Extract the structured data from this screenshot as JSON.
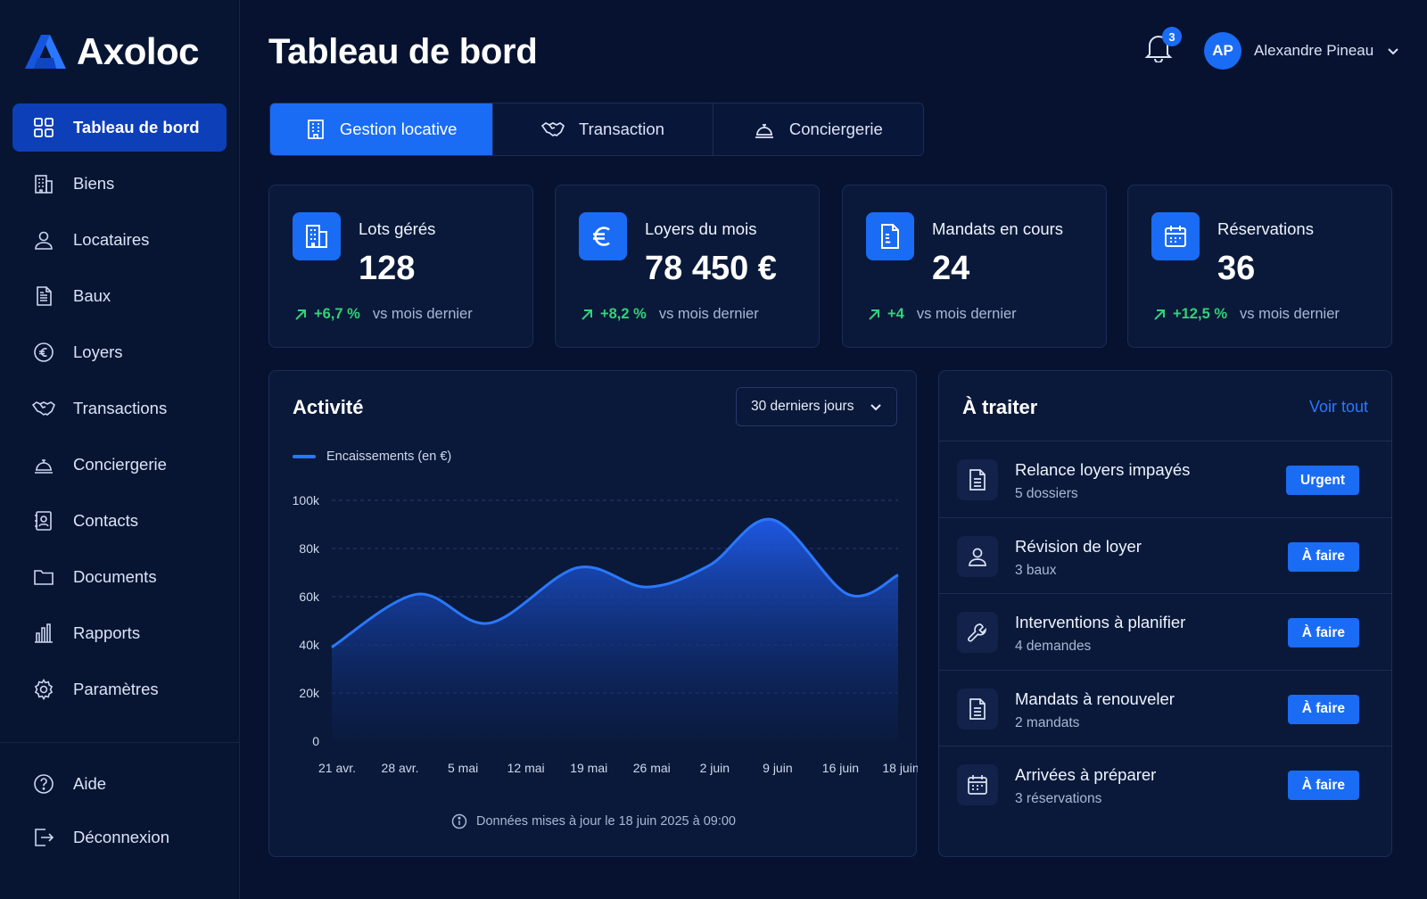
{
  "brand": {
    "name": "Axoloc",
    "logo_icon": "axoloc-logo-icon"
  },
  "sidebar": {
    "items": [
      {
        "label": "Tableau de bord",
        "icon": "grid-icon",
        "active": true
      },
      {
        "label": "Biens",
        "icon": "building-icon"
      },
      {
        "label": "Locataires",
        "icon": "user-icon"
      },
      {
        "label": "Baux",
        "icon": "document-icon"
      },
      {
        "label": "Loyers",
        "icon": "euro-icon"
      },
      {
        "label": "Transactions",
        "icon": "handshake-icon"
      },
      {
        "label": "Conciergerie",
        "icon": "bell-service-icon"
      },
      {
        "label": "Contacts",
        "icon": "contacts-icon"
      },
      {
        "label": "Documents",
        "icon": "folder-icon"
      },
      {
        "label": "Rapports",
        "icon": "bar-chart-icon"
      },
      {
        "label": "Paramètres",
        "icon": "gear-icon"
      }
    ],
    "bottom": [
      {
        "label": "Aide",
        "icon": "help-icon"
      },
      {
        "label": "Déconnexion",
        "icon": "logout-icon"
      }
    ]
  },
  "header": {
    "title": "Tableau de bord",
    "notifications_count": "3",
    "user_initials": "AP",
    "user_name": "Alexandre Pineau"
  },
  "tabs": [
    {
      "label": "Gestion locative",
      "icon": "building-icon",
      "active": true
    },
    {
      "label": "Transaction",
      "icon": "handshake-icon"
    },
    {
      "label": "Conciergerie",
      "icon": "bell-service-icon"
    }
  ],
  "stats": [
    {
      "label": "Lots gérés",
      "value": "128",
      "delta": "+6,7 %",
      "vs": "vs mois dernier",
      "icon": "building-icon"
    },
    {
      "label": "Loyers du mois",
      "value": "78 450 €",
      "delta": "+8,2 %",
      "vs": "vs mois dernier",
      "icon": "euro-icon"
    },
    {
      "label": "Mandats en cours",
      "value": "24",
      "delta": "+4",
      "vs": "vs mois dernier",
      "icon": "contract-icon"
    },
    {
      "label": "Réservations",
      "value": "36",
      "delta": "+12,5 %",
      "vs": "vs mois dernier",
      "icon": "calendar-icon"
    }
  ],
  "activity": {
    "title": "Activité",
    "range_label": "30 derniers jours",
    "legend": "Encaissements (en €)",
    "update_note": "Données mises à jour le 18 juin 2025 à 09:00"
  },
  "chart_data": {
    "type": "area",
    "series": [
      {
        "name": "Encaissements (en €)",
        "values": [
          39000,
          61000,
          49000,
          72000,
          64000,
          74000,
          92000,
          70000,
          61000,
          69000
        ]
      }
    ],
    "x": [
      "21 avr.",
      "28 avr.",
      "5 mai",
      "12 mai",
      "19 mai",
      "26 mai",
      "2 juin",
      "9 juin",
      "16 juin",
      "18 juin"
    ],
    "xlabels": [
      "21 avr.",
      "28 avr.",
      "5 mai",
      "12 mai",
      "19 mai",
      "26 mai",
      "2 juin",
      "9 juin",
      "16 juin",
      "18 juin"
    ],
    "curve_points": [
      [
        0,
        39000
      ],
      [
        1.35,
        61000
      ],
      [
        2.5,
        49000
      ],
      [
        3.9,
        72000
      ],
      [
        5.0,
        64000
      ],
      [
        6.0,
        73000
      ],
      [
        7.0,
        92000
      ],
      [
        8.2,
        61000
      ],
      [
        9.0,
        69000
      ]
    ],
    "yticks": [
      "0",
      "20k",
      "40k",
      "60k",
      "80k",
      "100k"
    ],
    "ylim": [
      0,
      100000
    ],
    "grid": true,
    "color": "#2a78ff"
  },
  "todo": {
    "title": "À traiter",
    "see_all": "Voir tout",
    "items": [
      {
        "name": "Relance loyers impayés",
        "sub": "5 dossiers",
        "action": "Urgent",
        "icon": "document-icon"
      },
      {
        "name": "Révision de loyer",
        "sub": "3 baux",
        "action": "À faire",
        "icon": "user-icon"
      },
      {
        "name": "Interventions à planifier",
        "sub": "4 demandes",
        "action": "À faire",
        "icon": "wrench-icon"
      },
      {
        "name": "Mandats à renouveler",
        "sub": "2 mandats",
        "action": "À faire",
        "icon": "document-icon"
      },
      {
        "name": "Arrivées à préparer",
        "sub": "3 réservations",
        "action": "À faire",
        "icon": "calendar-icon"
      }
    ]
  }
}
